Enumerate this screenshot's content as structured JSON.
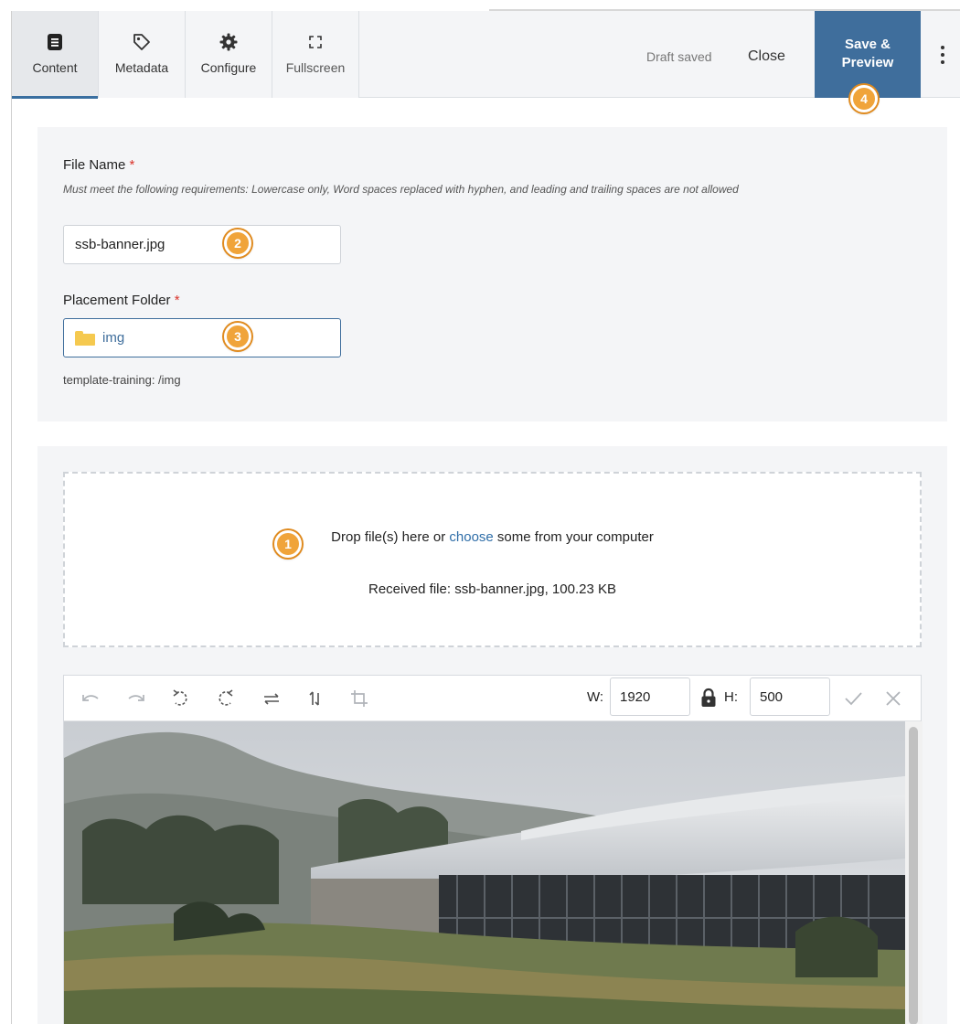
{
  "toolbar": {
    "tabs": [
      {
        "label": "Content",
        "icon": "document-icon"
      },
      {
        "label": "Metadata",
        "icon": "tag-icon"
      },
      {
        "label": "Configure",
        "icon": "gear-icon"
      },
      {
        "label": "Fullscreen",
        "icon": "fullscreen-icon"
      }
    ],
    "status": "Draft saved",
    "close_label": "Close",
    "save_label_line1": "Save &",
    "save_label_line2": "Preview"
  },
  "form": {
    "file_name_label": "File Name",
    "required_mark": "*",
    "file_name_hint": "Must meet the following requirements: Lowercase only, Word spaces replaced with hyphen, and leading and trailing spaces are not allowed",
    "file_name_value": "ssb-banner.jpg",
    "placement_label": "Placement Folder",
    "placement_value": "img",
    "placement_path": "template-training: /img"
  },
  "upload": {
    "drop_text_before": "Drop file(s) here or ",
    "drop_link": "choose",
    "drop_text_after": " some from your computer",
    "received": "Received file: ssb-banner.jpg, 100.23 KB"
  },
  "editor": {
    "tools": [
      "undo-icon",
      "redo-icon",
      "rotate-left-icon",
      "rotate-right-icon",
      "flip-horizontal-icon",
      "flip-vertical-icon",
      "crop-icon"
    ],
    "width_label": "W:",
    "width_value": "1920",
    "height_label": "H:",
    "height_value": "500"
  },
  "callouts": [
    "1",
    "2",
    "3",
    "4"
  ],
  "colors": {
    "accent": "#3f6e9c",
    "callout": "#f0a43a",
    "required": "#d9342b",
    "link": "#2f6ea8"
  }
}
